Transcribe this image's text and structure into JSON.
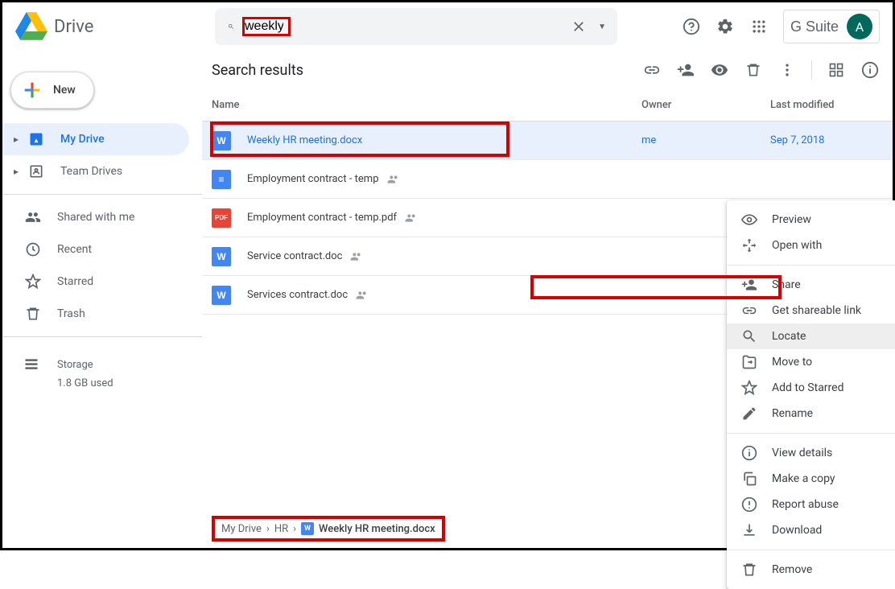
{
  "app": {
    "name": "Drive"
  },
  "search": {
    "value": "weekly"
  },
  "header": {
    "suite_label": "G Suite",
    "avatar_letter": "A"
  },
  "newButton": {
    "label": "New"
  },
  "sidebar": {
    "items": [
      {
        "label": "My Drive",
        "icon": "drive",
        "active": true,
        "caret": true
      },
      {
        "label": "Team Drives",
        "icon": "team-drive",
        "active": false,
        "caret": true
      },
      {
        "label": "Shared with me",
        "icon": "people",
        "active": false
      },
      {
        "label": "Recent",
        "icon": "clock",
        "active": false
      },
      {
        "label": "Starred",
        "icon": "star",
        "active": false
      },
      {
        "label": "Trash",
        "icon": "trash",
        "active": false
      }
    ],
    "storage": {
      "label": "Storage",
      "used": "1.8 GB used"
    }
  },
  "main": {
    "title": "Search results",
    "columns": {
      "name": "Name",
      "owner": "Owner",
      "modified": "Last modified"
    },
    "files": [
      {
        "name": "Weekly HR meeting.docx",
        "type": "word",
        "owner": "me",
        "modified": "Sep 7, 2018",
        "shared": false,
        "selected": true
      },
      {
        "name": "Employment contract - temp",
        "type": "doc",
        "owner": "",
        "modified": "",
        "shared": true,
        "selected": false
      },
      {
        "name": "Employment contract - temp.pdf",
        "type": "pdf",
        "owner": "",
        "modified": "",
        "shared": true,
        "selected": false
      },
      {
        "name": "Service contract.doc",
        "type": "word",
        "owner": "",
        "modified": "",
        "shared": true,
        "selected": false
      },
      {
        "name": "Services contract.doc",
        "type": "word",
        "owner": "",
        "modified": "",
        "shared": true,
        "selected": false
      }
    ]
  },
  "contextMenu": {
    "groups": [
      [
        {
          "label": "Preview",
          "icon": "eye"
        },
        {
          "label": "Open with",
          "icon": "open-with",
          "arrow": true
        }
      ],
      [
        {
          "label": "Share",
          "icon": "person-add"
        },
        {
          "label": "Get shareable link",
          "icon": "link"
        },
        {
          "label": "Locate",
          "icon": "search",
          "highlighted": true
        },
        {
          "label": "Move to",
          "icon": "move"
        },
        {
          "label": "Add to Starred",
          "icon": "star"
        },
        {
          "label": "Rename",
          "icon": "pencil"
        }
      ],
      [
        {
          "label": "View details",
          "icon": "info"
        },
        {
          "label": "Make a copy",
          "icon": "copy"
        },
        {
          "label": "Report abuse",
          "icon": "report"
        },
        {
          "label": "Download",
          "icon": "download"
        }
      ],
      [
        {
          "label": "Remove",
          "icon": "trash"
        }
      ]
    ]
  },
  "breadcrumb": {
    "segments": [
      "My Drive",
      "HR"
    ],
    "current": "Weekly HR meeting.docx"
  }
}
